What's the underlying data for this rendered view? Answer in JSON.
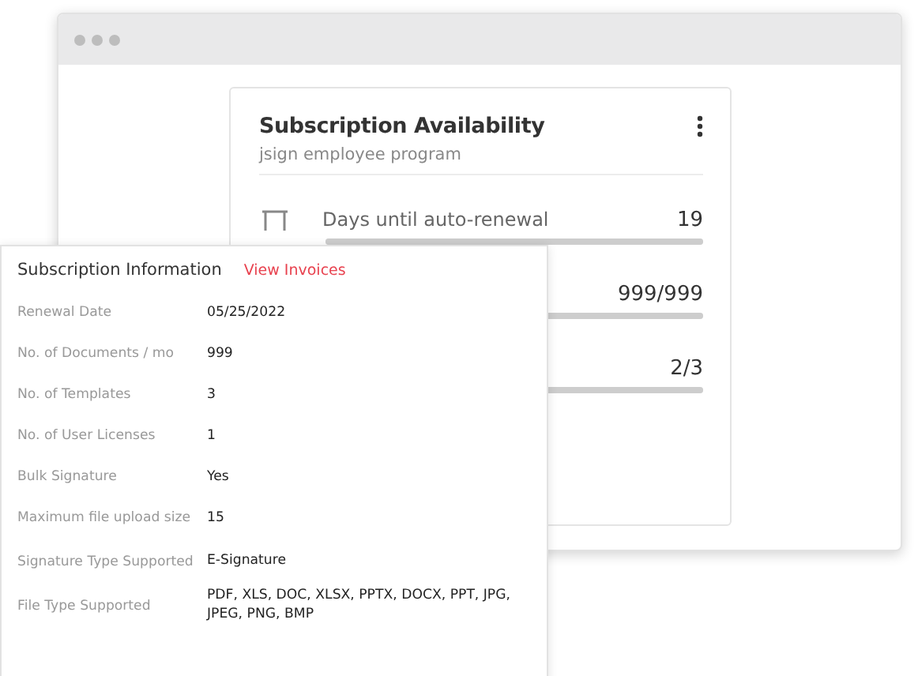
{
  "card": {
    "title": "Subscription Availability",
    "subtitle": "jsign employee program",
    "rows": [
      {
        "label": "Days until auto-renewal",
        "value": "19",
        "level": 1
      },
      {
        "value": "999/999",
        "level": 1
      },
      {
        "value": "2/3",
        "level": 1
      }
    ]
  },
  "info": {
    "title": "Subscription Information",
    "link": "View Invoices",
    "rows": [
      {
        "label": "Renewal Date",
        "value": "05/25/2022"
      },
      {
        "label": "No. of Documents / mo",
        "value": "999"
      },
      {
        "label": "No. of Templates",
        "value": "3"
      },
      {
        "label": "No. of User Licenses",
        "value": "1"
      },
      {
        "label": "Bulk Signature",
        "value": "Yes"
      },
      {
        "label": "Maximum file upload size",
        "value": "15"
      },
      {
        "label": "Signature Type Supported",
        "value": "E-Signature"
      },
      {
        "label": "File Type Supported",
        "value": "PDF, XLS, DOC, XLSX, PPTX, DOCX, PPT, JPG, JPEG, PNG, BMP"
      }
    ]
  }
}
